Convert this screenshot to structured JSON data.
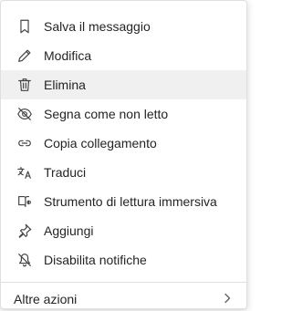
{
  "menu": {
    "items": [
      {
        "label": "Salva il messaggio",
        "icon": "bookmark-icon"
      },
      {
        "label": "Modifica",
        "icon": "pencil-icon"
      },
      {
        "label": "Elimina",
        "icon": "trash-icon"
      },
      {
        "label": "Segna come non letto",
        "icon": "eye-off-icon"
      },
      {
        "label": "Copia collegamento",
        "icon": "link-icon"
      },
      {
        "label": "Traduci",
        "icon": "translate-icon"
      },
      {
        "label": "Strumento di lettura immersiva",
        "icon": "immersive-reader-icon"
      },
      {
        "label": "Aggiungi",
        "icon": "pin-icon"
      },
      {
        "label": "Disabilita notifiche",
        "icon": "bell-off-icon"
      }
    ],
    "footer_label": "Altre azioni",
    "footer_icon": "chevron-right-icon"
  },
  "colors": {
    "text": "#242424",
    "icon": "#424242",
    "hover_background": "#f0f0f0",
    "border": "#e1dfdd"
  }
}
